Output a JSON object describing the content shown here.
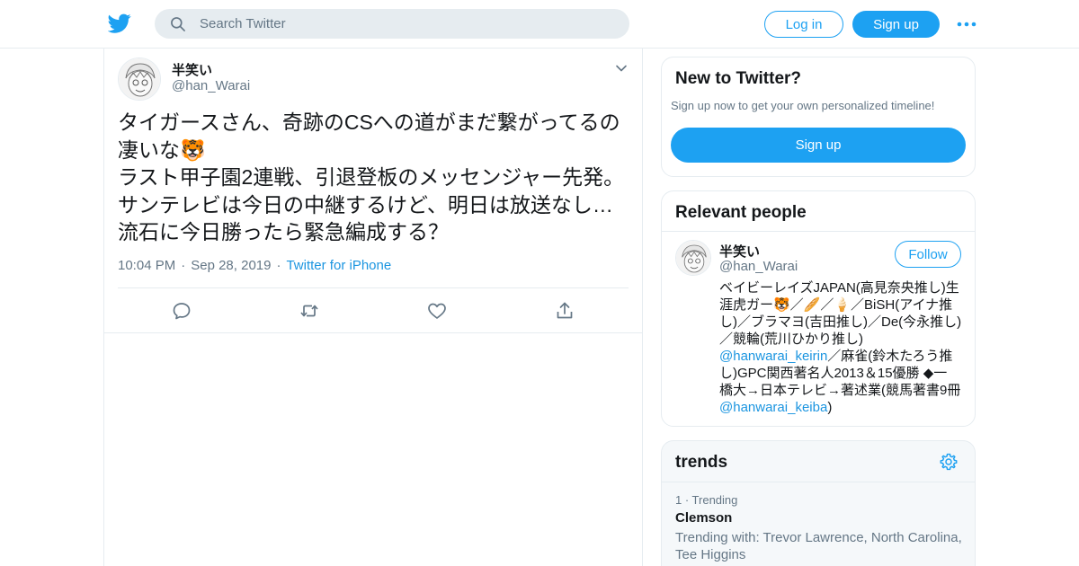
{
  "search": {
    "placeholder": "Search Twitter"
  },
  "header": {
    "login_label": "Log in",
    "signup_label": "Sign up"
  },
  "tweet": {
    "author_name": "半笑い",
    "author_handle": "@han_Warai",
    "text": "タイガースさん、奇跡のCSへの道がまだ繋がってるの凄いな🐯\nラスト甲子園2連戦、引退登板のメッセンジャー先発。サンテレビは今日の中継するけど、明日は放送なし…流石に今日勝ったら緊急編成する？",
    "time": "10:04 PM",
    "date": "Sep 28, 2019",
    "source": "Twitter for iPhone"
  },
  "new_to_twitter": {
    "title": "New to Twitter?",
    "subtitle": "Sign up now to get your own personalized timeline!",
    "signup_label": "Sign up"
  },
  "relevant_people": {
    "title": "Relevant people",
    "name": "半笑い",
    "handle": "@han_Warai",
    "follow_label": "Follow",
    "bio_lines": [
      "ベイビーレイズJAPAN(高見奈央推し)生",
      "涯虎ガー🐯／🥖／🍦／BiSH(アイナ推",
      "し)／ブラマヨ(吉田推し)／De(今永推し)",
      "／競輪(荒川ひかり推し)"
    ],
    "bio_mention1": "@hanwarai_keirin",
    "bio_after1": "／麻雀(鈴木たろう推",
    "bio_lines2": [
      "し)GPC関西著名人2013＆15優勝 ◆一",
      "橋大→日本テレビ→著述業(競馬著書9冊"
    ],
    "bio_mention2": "@hanwarai_keiba",
    "bio_close": ")"
  },
  "trends": {
    "title": "trends",
    "items": [
      {
        "rank": "1 · Trending",
        "name": "Clemson",
        "with": "Trending with: Trevor Lawrence, North Carolina, Tee Higgins"
      }
    ]
  },
  "colors": {
    "accent": "#1da1f2",
    "link": "#1b95e0",
    "muted": "#657786",
    "border": "#e6ecf0"
  },
  "icons": [
    "twitter-logo-icon",
    "search-icon",
    "more-dots-icon",
    "caret-down-icon",
    "reply-icon",
    "retweet-icon",
    "like-icon",
    "share-icon",
    "gear-icon"
  ]
}
